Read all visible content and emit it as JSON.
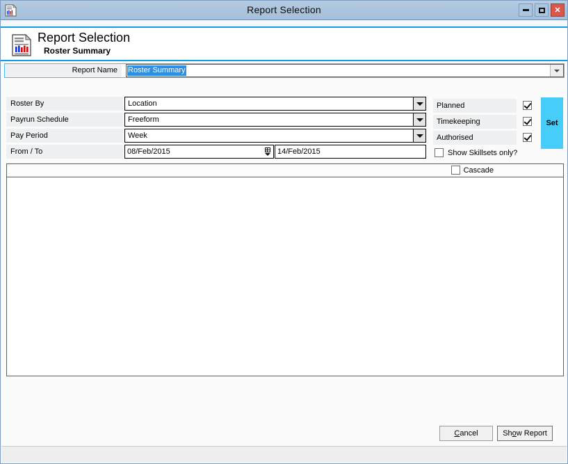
{
  "window": {
    "title": "Report Selection",
    "icon": "report-chart-icon",
    "minimize_label": "Minimize",
    "maximize_label": "Maximize",
    "close_label": "✕"
  },
  "header": {
    "title": "Report Selection",
    "subtitle": "Roster Summary",
    "icon": "report-document-chart-icon"
  },
  "report_name": {
    "label": "Report Name",
    "value": "Roster Summary",
    "selected": true
  },
  "fields": [
    {
      "label": "Roster By",
      "value": "Location"
    },
    {
      "label": "Payrun Schedule",
      "value": "Freeform"
    },
    {
      "label": "Pay Period",
      "value": "Week"
    }
  ],
  "date_range": {
    "label": "From / To",
    "from": "08/Feb/2015",
    "to": "14/Feb/2015"
  },
  "options": {
    "items": [
      {
        "label": "Planned",
        "checked": true
      },
      {
        "label": "Timekeeping",
        "checked": true
      },
      {
        "label": "Authorised",
        "checked": true
      }
    ],
    "skillsets": {
      "label": "Show Skillsets only?",
      "checked": false
    },
    "set_button": "Set"
  },
  "grid": {
    "cascade": {
      "label": "Cascade",
      "checked": false
    },
    "rows": []
  },
  "footer": {
    "cancel": {
      "pre": "",
      "accel": "C",
      "post": "ancel"
    },
    "show_report": {
      "pre": "Sh",
      "accel": "o",
      "post": "w Report"
    }
  },
  "statusbar": {
    "text": ""
  },
  "colors": {
    "accent": "#0d9ee5",
    "set_button": "#46cdf9",
    "titlebar": "#aac4dd",
    "close": "#d9584b",
    "selection": "#2f8fe0",
    "label_bg": "#eff0f1"
  }
}
